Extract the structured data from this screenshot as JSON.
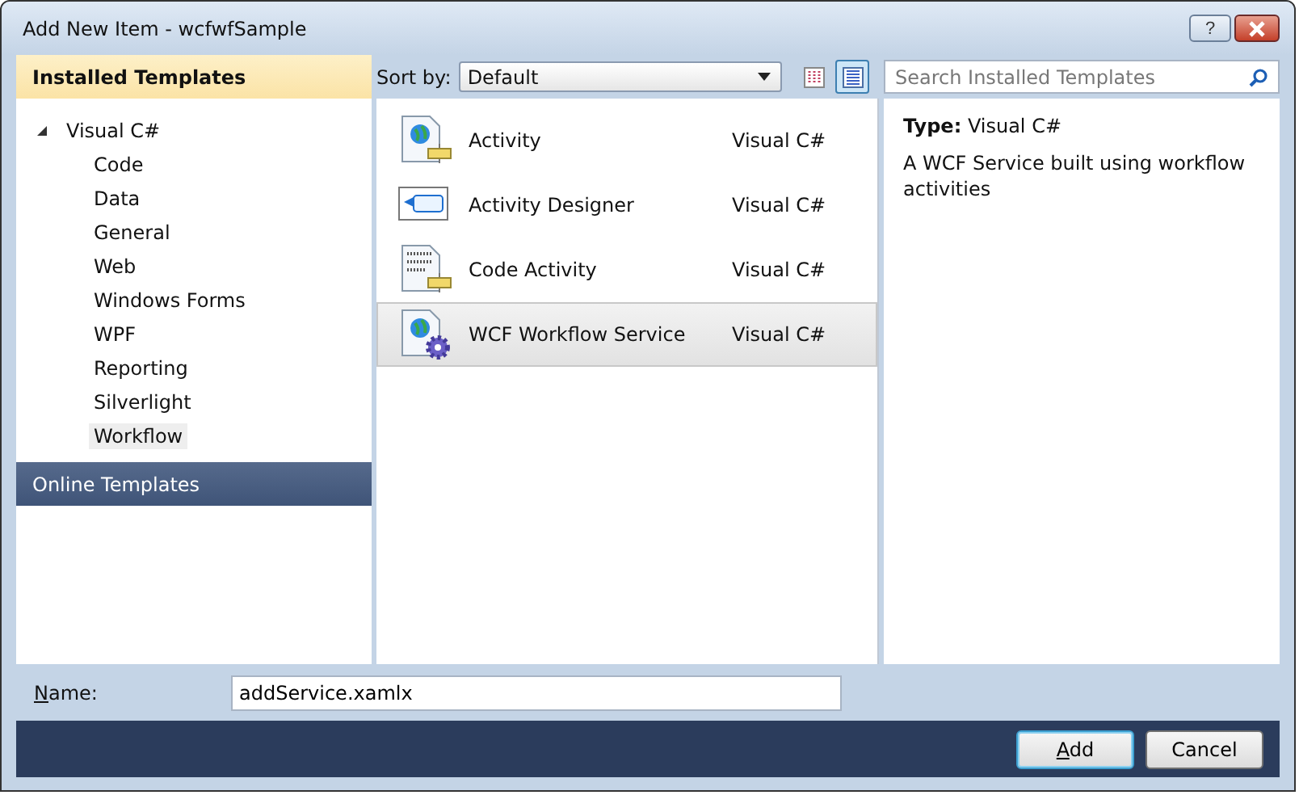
{
  "window": {
    "title": "Add New Item - wcfwfSample",
    "help": "?"
  },
  "sidebar": {
    "installed_header": "Installed Templates",
    "tree": [
      {
        "label": "Visual C#",
        "expanded": true,
        "selected": false,
        "children": [
          {
            "label": "Code",
            "selected": false
          },
          {
            "label": "Data",
            "selected": false
          },
          {
            "label": "General",
            "selected": false
          },
          {
            "label": "Web",
            "selected": false
          },
          {
            "label": "Windows Forms",
            "selected": false
          },
          {
            "label": "WPF",
            "selected": false
          },
          {
            "label": "Reporting",
            "selected": false
          },
          {
            "label": "Silverlight",
            "selected": false
          },
          {
            "label": "Workflow",
            "selected": true
          }
        ]
      }
    ],
    "online_header": "Online Templates"
  },
  "toolbar": {
    "sort_label": "Sort by:",
    "sort_value": "Default",
    "views": [
      {
        "kind": "columns",
        "selected": false
      },
      {
        "kind": "list",
        "selected": true
      }
    ]
  },
  "search": {
    "placeholder": "Search Installed Templates"
  },
  "templates": [
    {
      "kind": "activity",
      "name": "Activity",
      "language": "Visual C#",
      "selected": false
    },
    {
      "kind": "designer",
      "name": "Activity Designer",
      "language": "Visual C#",
      "selected": false
    },
    {
      "kind": "code",
      "name": "Code Activity",
      "language": "Visual C#",
      "selected": false
    },
    {
      "kind": "service",
      "name": "WCF Workflow Service",
      "language": "Visual C#",
      "selected": true
    }
  ],
  "details": {
    "type": "**Type:**  Visual C#",
    "description": "A WCF Service built using workflow activities"
  },
  "name_field": {
    "label": "Name:",
    "value": "addService.xamlx"
  },
  "buttons": [
    {
      "label": "Add",
      "default": true
    },
    {
      "label": "Cancel",
      "default": false
    }
  ]
}
